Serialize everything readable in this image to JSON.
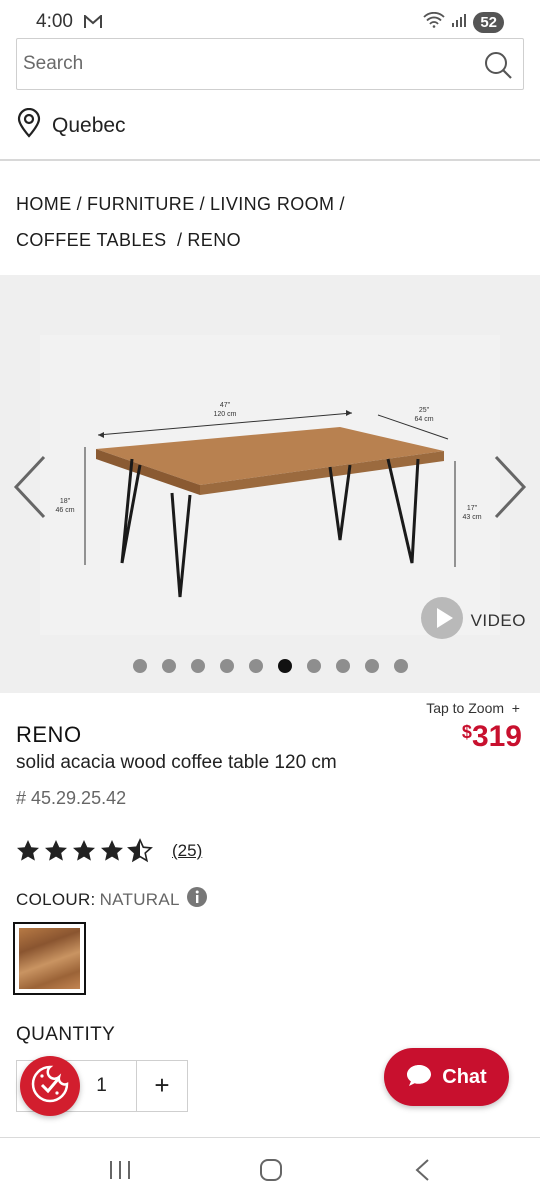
{
  "status_bar": {
    "time": "4:00",
    "battery": "52"
  },
  "search": {
    "placeholder": "Search"
  },
  "location": {
    "label": "Quebec"
  },
  "breadcrumb": [
    {
      "label": "HOME"
    },
    {
      "label": "FURNITURE"
    },
    {
      "label": "LIVING ROOM"
    },
    {
      "label": "COFFEE TABLES"
    },
    {
      "label": "RENO"
    }
  ],
  "gallery": {
    "dimensions": {
      "width": "47\"",
      "width_cm": "120 cm",
      "depth": "25\"",
      "depth_cm": "64 cm",
      "height_left": "18\"",
      "height_left_cm": "46 cm",
      "height_right": "17\"",
      "height_right_cm": "43 cm"
    },
    "video_label": "VIDEO",
    "dot_count": 10,
    "active_dot": 5
  },
  "product": {
    "tap_to_zoom": "Tap to Zoom",
    "name": "RENO",
    "price_currency": "$",
    "price": "319",
    "description": "solid acacia wood coffee table 120 cm",
    "sku": "# 45.29.25.42",
    "rating": 4.5,
    "review_count": "(25)",
    "colour_label": "COLOUR:",
    "colour_value": "NATURAL",
    "quantity_label": "QUANTITY",
    "quantity_value": "1",
    "quantity_plus": "+"
  },
  "chat": {
    "label": "Chat"
  },
  "colors": {
    "brand_red": "#c8102e",
    "star": "#222222"
  }
}
